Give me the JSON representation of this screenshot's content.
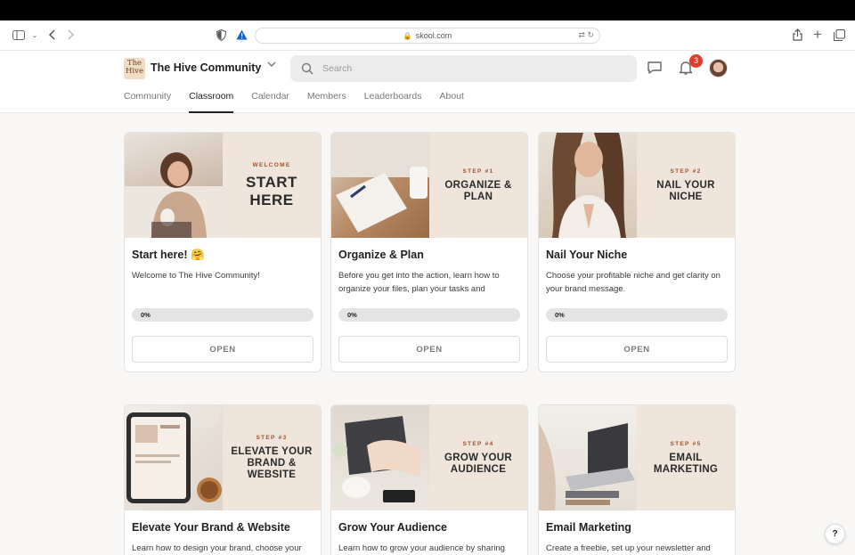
{
  "browser": {
    "url": "skool.com"
  },
  "header": {
    "logo_text": "The Hive",
    "community_name": "The Hive Community",
    "search_placeholder": "Search",
    "notification_count": "3"
  },
  "nav": {
    "tabs": [
      {
        "label": "Community",
        "active": false
      },
      {
        "label": "Classroom",
        "active": true
      },
      {
        "label": "Calendar",
        "active": false
      },
      {
        "label": "Members",
        "active": false
      },
      {
        "label": "Leaderboards",
        "active": false
      },
      {
        "label": "About",
        "active": false
      }
    ]
  },
  "courses": [
    {
      "cover_step": "WELCOME",
      "cover_title": "START HERE",
      "title": "Start here! 🤗",
      "description": "Welcome to The Hive Community!",
      "progress": "0%",
      "progress_value": 0,
      "button": "OPEN"
    },
    {
      "cover_step": "STEP #1",
      "cover_title": "ORGANIZE & PLAN",
      "title": "Organize & Plan",
      "description": "Before you get into the action, learn how to organize your files, plan your tasks and",
      "progress": "0%",
      "progress_value": 0,
      "button": "OPEN"
    },
    {
      "cover_step": "STEP #2",
      "cover_title": "NAIL YOUR NICHE",
      "title": "Nail Your Niche",
      "description": "Choose your profitable niche and get clarity on your brand message.",
      "progress": "0%",
      "progress_value": 0,
      "button": "OPEN"
    },
    {
      "cover_step": "STEP #3",
      "cover_title": "ELEVATE YOUR BRAND & WEBSITE",
      "title": "Elevate Your Brand & Website",
      "description": "Learn how to design your brand, choose your",
      "progress": "",
      "button": ""
    },
    {
      "cover_step": "STEP #4",
      "cover_title": "GROW YOUR AUDIENCE",
      "title": "Grow Your Audience",
      "description": "Learn how to grow your audience by sharing",
      "progress": "",
      "button": ""
    },
    {
      "cover_step": "STEP #5",
      "cover_title": "EMAIL MARKETING",
      "title": "Email Marketing",
      "description": "Create a freebie, set up your newsletter and",
      "progress": "",
      "button": ""
    }
  ],
  "help": {
    "label": "?"
  },
  "colors": {
    "accent_step": "#a0522d",
    "cover_panel": "#efe5da",
    "badge": "#e23c2c"
  }
}
